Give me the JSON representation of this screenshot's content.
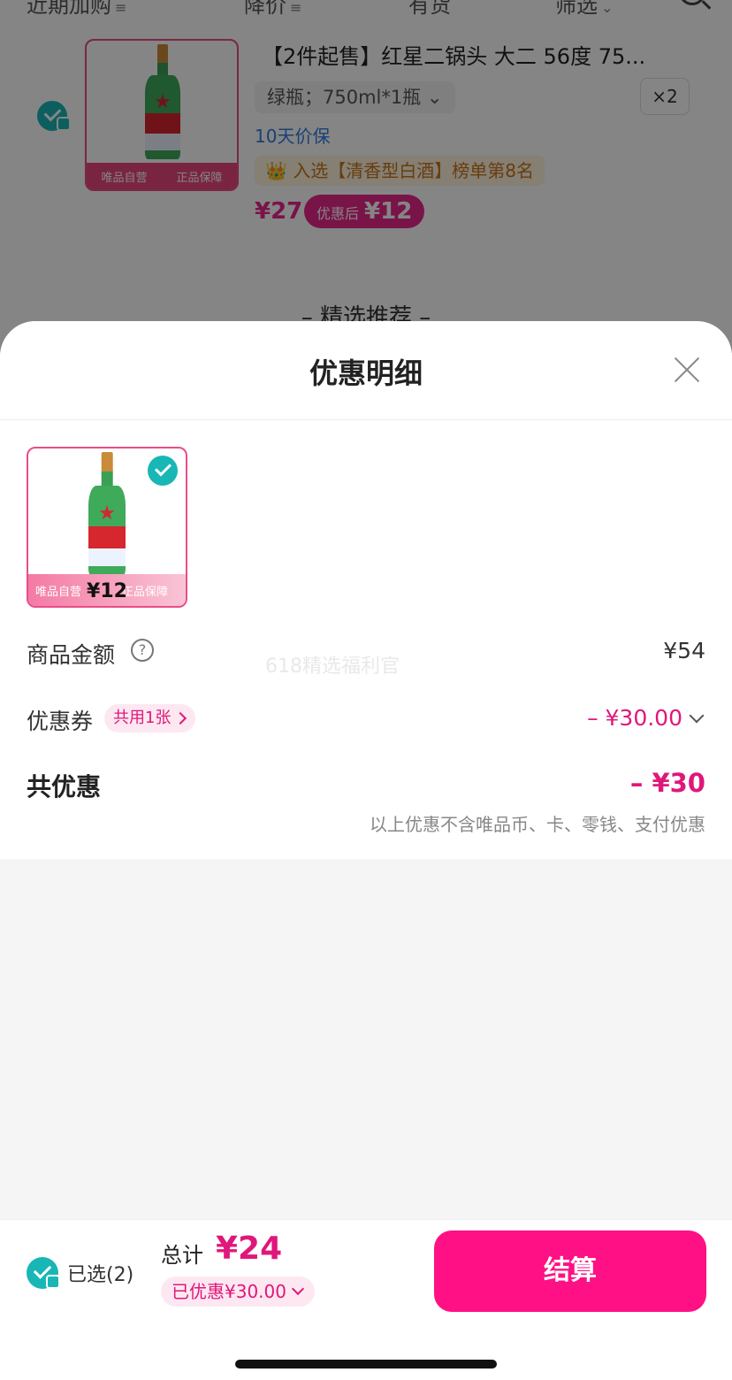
{
  "background": {
    "filters": [
      {
        "label": "近期加购",
        "suffix": "≡"
      },
      {
        "label": "降价",
        "suffix": "≡"
      },
      {
        "label": "有货",
        "suffix": ""
      },
      {
        "label": "筛选",
        "suffix": "⌄"
      }
    ],
    "product": {
      "title": "【2件起售】红星二锅头 大二 56度 75...",
      "spec": "绿瓶；750ml*1瓶 ⌄",
      "quantity": "×2",
      "price_protect": "10天价保",
      "rank": "👑 入选【清香型白酒】榜单第8名",
      "price": "¥27",
      "after_label": "优惠后",
      "after_price": "¥12",
      "badge_self": "唯品自营",
      "badge_genuine": "正品保障"
    },
    "section_title": "– 精选推荐 –"
  },
  "sheet": {
    "title": "优惠明细",
    "item": {
      "price": "¥12",
      "badge_self": "唯品自营",
      "badge_genuine": "正品保障"
    },
    "goods_amount_label": "商品金额",
    "goods_amount_value": "¥54",
    "watermark": "618精选福利官",
    "coupon_label": "优惠券",
    "coupon_tag": "共用1张",
    "coupon_value": "– ¥30.00",
    "total_discount_label": "共优惠",
    "total_discount_value": "– ¥30",
    "note": "以上优惠不含唯品币、卡、零钱、支付优惠"
  },
  "bottom_bar": {
    "selected_label": "已选(2)",
    "total_label": "总计",
    "total_value": "¥24",
    "saved_label": "已优惠¥30.00",
    "checkout_label": "结算"
  },
  "colors": {
    "accent": "#e0177a",
    "checkout": "#ff1085",
    "check": "#19b6b6"
  }
}
